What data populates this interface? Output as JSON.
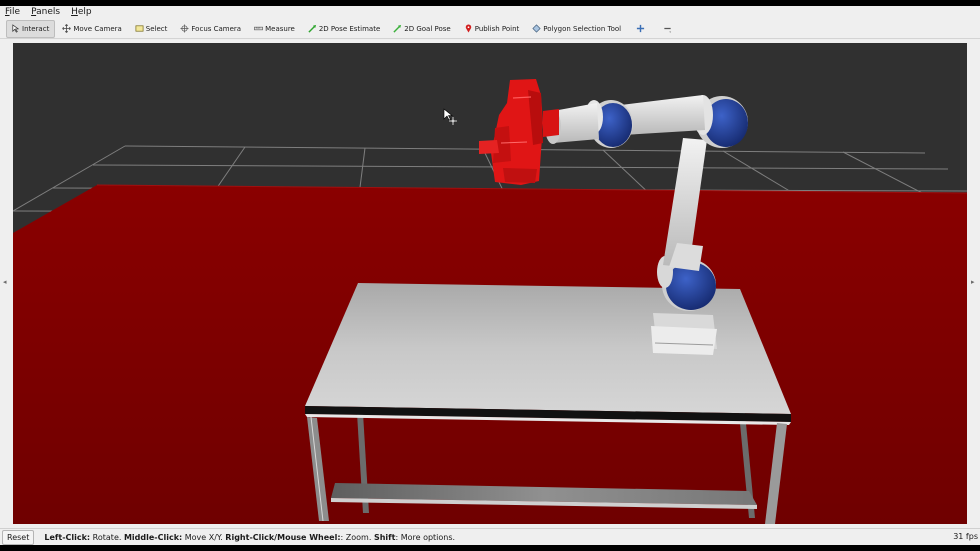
{
  "menu": [
    {
      "label": "File",
      "underline": "F",
      "rest": "ile"
    },
    {
      "label": "Panels",
      "underline": "P",
      "rest": "anels"
    },
    {
      "label": "Help",
      "underline": "H",
      "rest": "elp"
    }
  ],
  "toolbar": {
    "interact": "Interact",
    "move_camera": "Move Camera",
    "select": "Select",
    "focus_camera": "Focus Camera",
    "measure": "Measure",
    "pose_estimate": "2D Pose Estimate",
    "goal_pose": "2D Goal Pose",
    "publish_point": "Publish Point",
    "polygon_tool": "Polygon Selection Tool",
    "active_tool": "Interact"
  },
  "status": {
    "reset": "Reset",
    "hint_left_key": "Left-Click:",
    "hint_left": " Rotate. ",
    "hint_middle_key": "Middle-Click:",
    "hint_middle": " Move X/Y. ",
    "hint_right_key": "Right-Click/Mouse Wheel:",
    "hint_right": ": Zoom. ",
    "hint_shift_key": "Shift",
    "hint_shift": ": More options.",
    "fps": "31 fps"
  },
  "scene": {
    "background_color": "#303030",
    "floor_color": "#7a0000",
    "grid_color": "#8c8c8c",
    "table_color": "#c4c4c4",
    "robot_joint_color": "#1f3f9a",
    "robot_link_color": "#d6d6d6",
    "gripper_color": "#e01010",
    "objects": [
      "ground-grid",
      "collision-floor",
      "table",
      "robot-arm",
      "gripper",
      "interaction-cursor"
    ]
  }
}
